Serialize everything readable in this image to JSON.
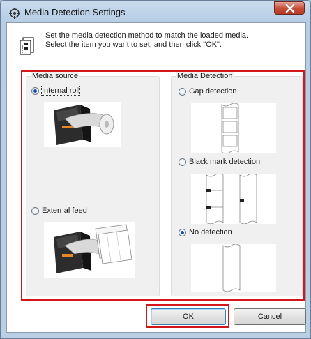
{
  "window": {
    "title": "Media Detection Settings",
    "close_symbol": "X"
  },
  "info": {
    "line1": "Set the media detection method to match the loaded media.",
    "line2": "Select the item you want to set, and then click \"OK\"."
  },
  "media_source": {
    "label": "Media source",
    "options": [
      {
        "label": "Internal roll",
        "checked": true
      },
      {
        "label": "External feed",
        "checked": false
      }
    ]
  },
  "media_detection": {
    "label": "Media Detection",
    "options": [
      {
        "label": "Gap detection",
        "checked": false
      },
      {
        "label": "Black mark detection",
        "checked": false
      },
      {
        "label": "No detection",
        "checked": true
      }
    ]
  },
  "buttons": {
    "ok": "OK",
    "cancel": "Cancel"
  },
  "colors": {
    "highlight_red": "#d4161b",
    "radio_dot": "#1a4fa8"
  }
}
